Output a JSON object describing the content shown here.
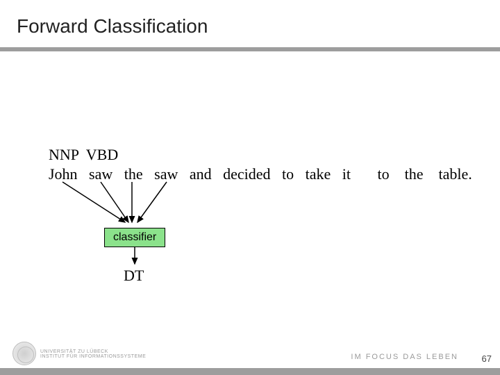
{
  "title": "Forward Classification",
  "tags_line": "NNP  VBD",
  "words_line": "John   saw   the   saw   and   decided   to   take   it       to    the    table.",
  "classifier_label": "classifier",
  "output_tag": "DT",
  "university": {
    "line1": "UNIVERSITÄT ZU LÜBECK",
    "line2": "INSTITUT FÜR INFORMATIONSSYSTEME"
  },
  "focus": {
    "prefix": "IM FOCUS DAS LEBEN"
  },
  "page_number": "67"
}
